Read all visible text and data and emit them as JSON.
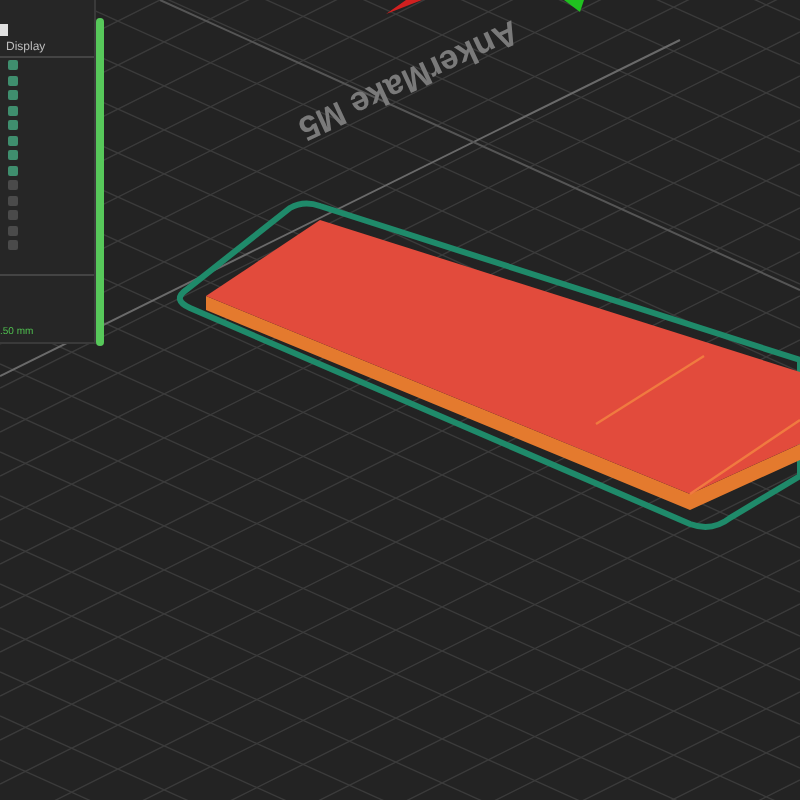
{
  "panel": {
    "column_header": "Display",
    "rows": [
      {
        "checked": true
      },
      {
        "checked": true
      },
      {
        "checked": true
      },
      {
        "checked": true
      },
      {
        "checked": true
      },
      {
        "checked": true
      },
      {
        "checked": true
      },
      {
        "checked": true
      },
      {
        "checked": false
      },
      {
        "checked": false
      },
      {
        "checked": false
      },
      {
        "checked": false
      },
      {
        "checked": false
      }
    ],
    "scale_label": ".50 mm"
  },
  "layer_slider": {
    "level": 1
  },
  "viewport": {
    "bed_label": "AnkerMake M5"
  }
}
